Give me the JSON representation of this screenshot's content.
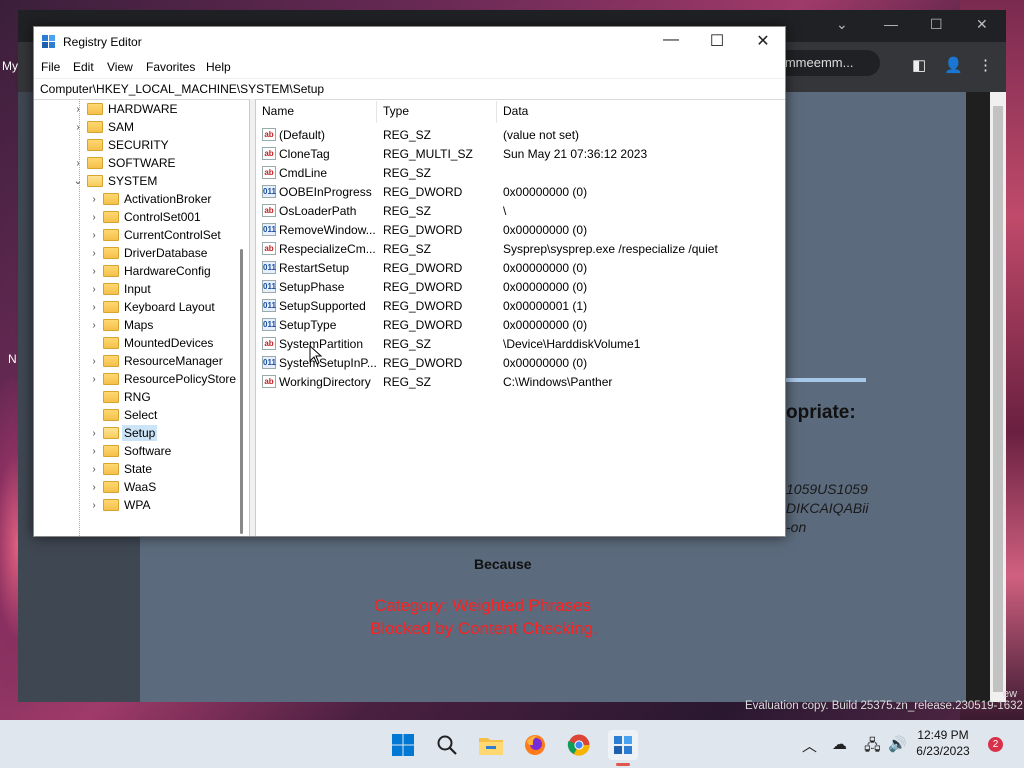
{
  "desktop": {
    "left_labels": [
      "My",
      "N"
    ],
    "watermark": "Evaluation copy. Build 25375.zn_release.230519-1632",
    "watermark_right": "ew"
  },
  "browser": {
    "omnibox_text": "q=mmeemm...",
    "page": {
      "heading_partial": "opriate:",
      "code_lines": [
        "1059US1059",
        "DIKCAIQABii",
        "-on"
      ],
      "because": "Because",
      "blocked_lines": [
        "Category: Weighted Phrases",
        "Blocked by Content Checking."
      ]
    }
  },
  "regedit": {
    "title": "Registry Editor",
    "menu": [
      "File",
      "Edit",
      "View",
      "Favorites",
      "Help"
    ],
    "path": "Computer\\HKEY_LOCAL_MACHINE\\SYSTEM\\Setup",
    "tree": {
      "root_items": [
        "HARDWARE",
        "SAM",
        "SECURITY",
        "SOFTWARE",
        "SYSTEM"
      ],
      "system_children": [
        "ActivationBroker",
        "ControlSet001",
        "CurrentControlSet",
        "DriverDatabase",
        "HardwareConfig",
        "Input",
        "Keyboard Layout",
        "Maps",
        "MountedDevices",
        "ResourceManager",
        "ResourcePolicyStore",
        "RNG",
        "Select",
        "Setup",
        "Software",
        "State",
        "WaaS",
        "WPA"
      ],
      "selected": "Setup"
    },
    "columns": [
      "Name",
      "Type",
      "Data"
    ],
    "values": [
      {
        "icon": "ab",
        "name": "(Default)",
        "type": "REG_SZ",
        "data": "(value not set)"
      },
      {
        "icon": "ab",
        "name": "CloneTag",
        "type": "REG_MULTI_SZ",
        "data": "Sun May 21 07:36:12 2023"
      },
      {
        "icon": "ab",
        "name": "CmdLine",
        "type": "REG_SZ",
        "data": ""
      },
      {
        "icon": "011",
        "name": "OOBEInProgress",
        "type": "REG_DWORD",
        "data": "0x00000000 (0)"
      },
      {
        "icon": "ab",
        "name": "OsLoaderPath",
        "type": "REG_SZ",
        "data": "\\"
      },
      {
        "icon": "011",
        "name": "RemoveWindow...",
        "type": "REG_DWORD",
        "data": "0x00000000 (0)"
      },
      {
        "icon": "ab",
        "name": "RespecializeCm...",
        "type": "REG_SZ",
        "data": "Sysprep\\sysprep.exe /respecialize /quiet"
      },
      {
        "icon": "011",
        "name": "RestartSetup",
        "type": "REG_DWORD",
        "data": "0x00000000 (0)"
      },
      {
        "icon": "011",
        "name": "SetupPhase",
        "type": "REG_DWORD",
        "data": "0x00000000 (0)"
      },
      {
        "icon": "011",
        "name": "SetupSupported",
        "type": "REG_DWORD",
        "data": "0x00000001 (1)"
      },
      {
        "icon": "011",
        "name": "SetupType",
        "type": "REG_DWORD",
        "data": "0x00000000 (0)"
      },
      {
        "icon": "ab",
        "name": "SystemPartition",
        "type": "REG_SZ",
        "data": "\\Device\\HarddiskVolume1"
      },
      {
        "icon": "011",
        "name": "SystemSetupInP...",
        "type": "REG_DWORD",
        "data": "0x00000000 (0)"
      },
      {
        "icon": "ab",
        "name": "WorkingDirectory",
        "type": "REG_SZ",
        "data": "C:\\Windows\\Panther"
      }
    ]
  },
  "taskbar": {
    "time": "12:49 PM",
    "date": "6/23/2023",
    "notification_count": "2",
    "accent": "#0067c0"
  }
}
